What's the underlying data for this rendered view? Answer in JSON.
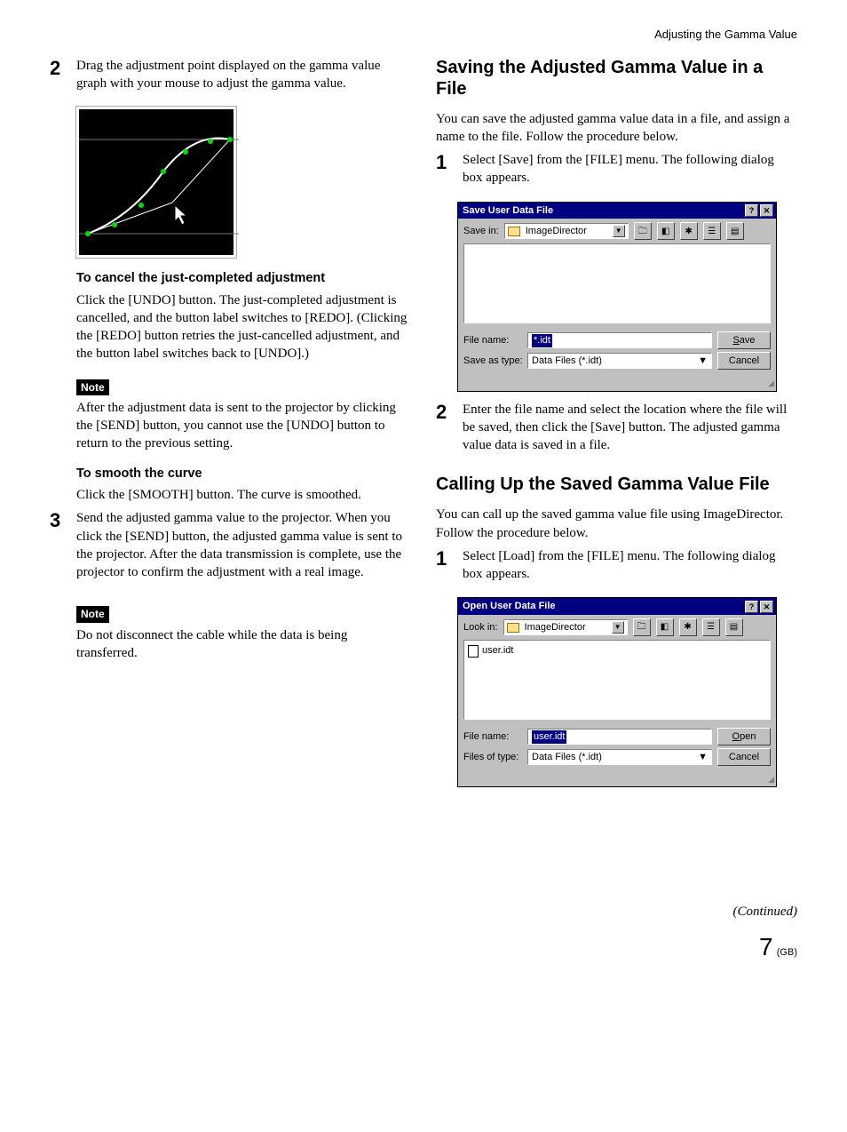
{
  "header": {
    "section": "Adjusting the Gamma Value"
  },
  "left": {
    "step2": {
      "num": "2",
      "text": "Drag the adjustment point displayed on the gamma value graph with your mouse to adjust the gamma value."
    },
    "cancel": {
      "head": "To cancel the just-completed adjustment",
      "body": "Click the [UNDO] button. The just-completed adjustment is cancelled, and the button label switches to [REDO]. (Clicking the [REDO] button retries the just-cancelled adjustment, and the button label switches back to [UNDO].)"
    },
    "note1": {
      "label": "Note",
      "body": "After the adjustment data is sent to the projector by clicking the [SEND] button, you cannot use the [UNDO] button to return to the previous setting."
    },
    "smooth": {
      "head": "To smooth the curve",
      "body": "Click the [SMOOTH] button. The curve is smoothed."
    },
    "step3": {
      "num": "3",
      "text": "Send the adjusted gamma value to the projector. When you click the [SEND] button, the adjusted gamma value is sent to the projector. After the data transmission is complete, use the projector to confirm the adjustment with a real image."
    },
    "note2": {
      "label": "Note",
      "body": "Do not disconnect the cable while the data is being transferred."
    }
  },
  "right": {
    "saving": {
      "title": "Saving the Adjusted Gamma Value in a File",
      "intro": "You can save the adjusted gamma value data in a file, and assign a name to the file. Follow the procedure below.",
      "step1": {
        "num": "1",
        "text": "Select [Save] from the [FILE] menu. The following dialog box appears."
      },
      "step2": {
        "num": "2",
        "text": "Enter the file name and select the location where the file will be saved, then click the [Save] button. The adjusted gamma value data is saved in a file."
      }
    },
    "calling": {
      "title": "Calling Up the Saved Gamma Value File",
      "intro": "You can call up the saved gamma value file using ImageDirector. Follow the procedure below.",
      "step1": {
        "num": "1",
        "text": "Select [Load] from the [FILE] menu. The following dialog box appears."
      }
    }
  },
  "saveDialog": {
    "title": "Save User Data File",
    "saveInLabel": "Save in:",
    "folder": "ImageDirector",
    "fileNameLabel": "File name:",
    "fileNameValue": "*.idt",
    "typeLabel": "Save as type:",
    "typeValue": "Data Files (*.idt)",
    "saveBtn": "Save",
    "cancelBtn": "Cancel"
  },
  "openDialog": {
    "title": "Open User Data File",
    "lookInLabel": "Look in:",
    "folder": "ImageDirector",
    "listItem": "user.idt",
    "fileNameLabel": "File name:",
    "fileNameValue": "user.idt",
    "typeLabel": "Files of type:",
    "typeValue": "Data Files (*.idt)",
    "openBtn": "Open",
    "cancelBtn": "Cancel"
  },
  "footer": {
    "continued": "(Continued)",
    "pageNum": "7",
    "region": "(GB)"
  },
  "glyphs": {
    "help": "?",
    "close": "✕",
    "down": "▼",
    "grip": "◢"
  }
}
